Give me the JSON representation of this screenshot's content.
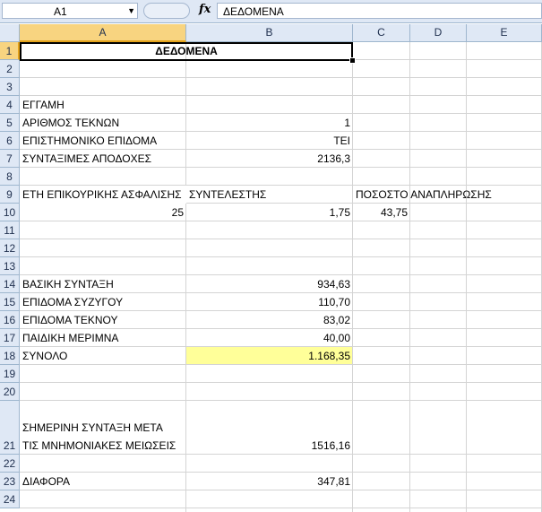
{
  "name_box": "A1",
  "formula_icon": "fx",
  "formula_text": "ΔΕΔΟΜΕΝΑ",
  "columns": [
    "A",
    "B",
    "C",
    "D",
    "E"
  ],
  "rows": [
    "1",
    "2",
    "3",
    "4",
    "5",
    "6",
    "7",
    "8",
    "9",
    "10",
    "11",
    "12",
    "13",
    "14",
    "15",
    "16",
    "17",
    "18",
    "19",
    "20",
    "21",
    "22",
    "23",
    "24"
  ],
  "cells": {
    "A1": "ΔΕΔΟΜΕΝΑ",
    "A4": "ΕΓΓΑΜΗ",
    "A5": "ΑΡΙΘΜΟΣ ΤΕΚΝΩΝ",
    "B5": "1",
    "A6": "ΕΠΙΣΤΗΜΟΝΙΚΟ ΕΠΙΔΟΜΑ",
    "B6": "ΤΕΙ",
    "A7": "ΣΥΝΤΑΞΙΜΕΣ ΑΠΟΔΟΧΕΣ",
    "B7": "2136,3",
    "A9": "ΕΤΗ ΕΠΙΚΟΥΡΙΚΗΣ ΑΣΦΑΛΙΣΗΣ",
    "B9": "ΣΥΝΤΕΛΕΣΤΗΣ",
    "C9": "ΠΟΣΟΣΤΟ ΑΝΑΠΛΗΡΩΣΗΣ",
    "A10": "25",
    "B10": "1,75",
    "C10": "43,75",
    "A14": "ΒΑΣΙΚΗ ΣΥΝΤΑΞΗ",
    "B14": "934,63",
    "A15": "ΕΠΙΔΟΜΑ ΣΥΖΥΓΟΥ",
    "B15": "110,70",
    "A16": "ΕΠΙΔΟΜΑ ΤΕΚΝΟΥ",
    "B16": "83,02",
    "A17": "ΠΑΙΔΙΚΗ ΜΕΡΙΜΝΑ",
    "B17": "40,00",
    "A18": "ΣΥΝΟΛΟ",
    "B18": "1.168,35",
    "A21_line1": "ΣΗΜΕΡΙΝΗ ΣΥΝΤΑΞΗ ΜΕΤΑ",
    "A21_line2": "ΤΙΣ ΜΝΗΜΟΝΙΑΚΕΣ ΜΕΙΩΣΕΙΣ",
    "B21": "1516,16",
    "A23": "ΔΙΑΦΟΡΑ",
    "B23": "347,81"
  },
  "colors": {
    "header_bg": "#dfe8f5",
    "selected_header": "#f8d480",
    "highlight_cell": "#ffff99",
    "gridline": "#d4d4d4"
  }
}
